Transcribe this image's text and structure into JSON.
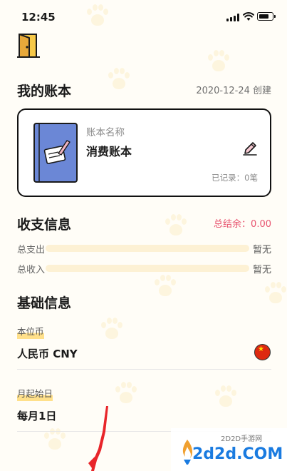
{
  "status_bar": {
    "time": "12:45"
  },
  "ledger": {
    "section_title": "我的账本",
    "created_date": "2020-12-24 创建",
    "card_label": "账本名称",
    "card_name": "消费账本",
    "record_count": "已记录：0笔"
  },
  "income_expense": {
    "section_title": "收支信息",
    "balance": "总结余：0.00",
    "total_expense_label": "总支出",
    "total_expense_value": "暂无",
    "total_income_label": "总收入",
    "total_income_value": "暂无"
  },
  "basic_info": {
    "section_title": "基础信息",
    "currency_label": "本位币",
    "currency_value": "人民币 CNY",
    "month_start_label": "月起始日",
    "month_start_value": "每月1日"
  },
  "watermark": {
    "small": "2D2D手游网",
    "big": "2d2d.COM"
  },
  "colors": {
    "accent_pink": "#e8536f",
    "card_blue": "#6b87d6",
    "highlight_yellow": "#ffe08a"
  },
  "icons": [
    "door-icon",
    "edit-pencil-icon",
    "china-flag-icon"
  ]
}
